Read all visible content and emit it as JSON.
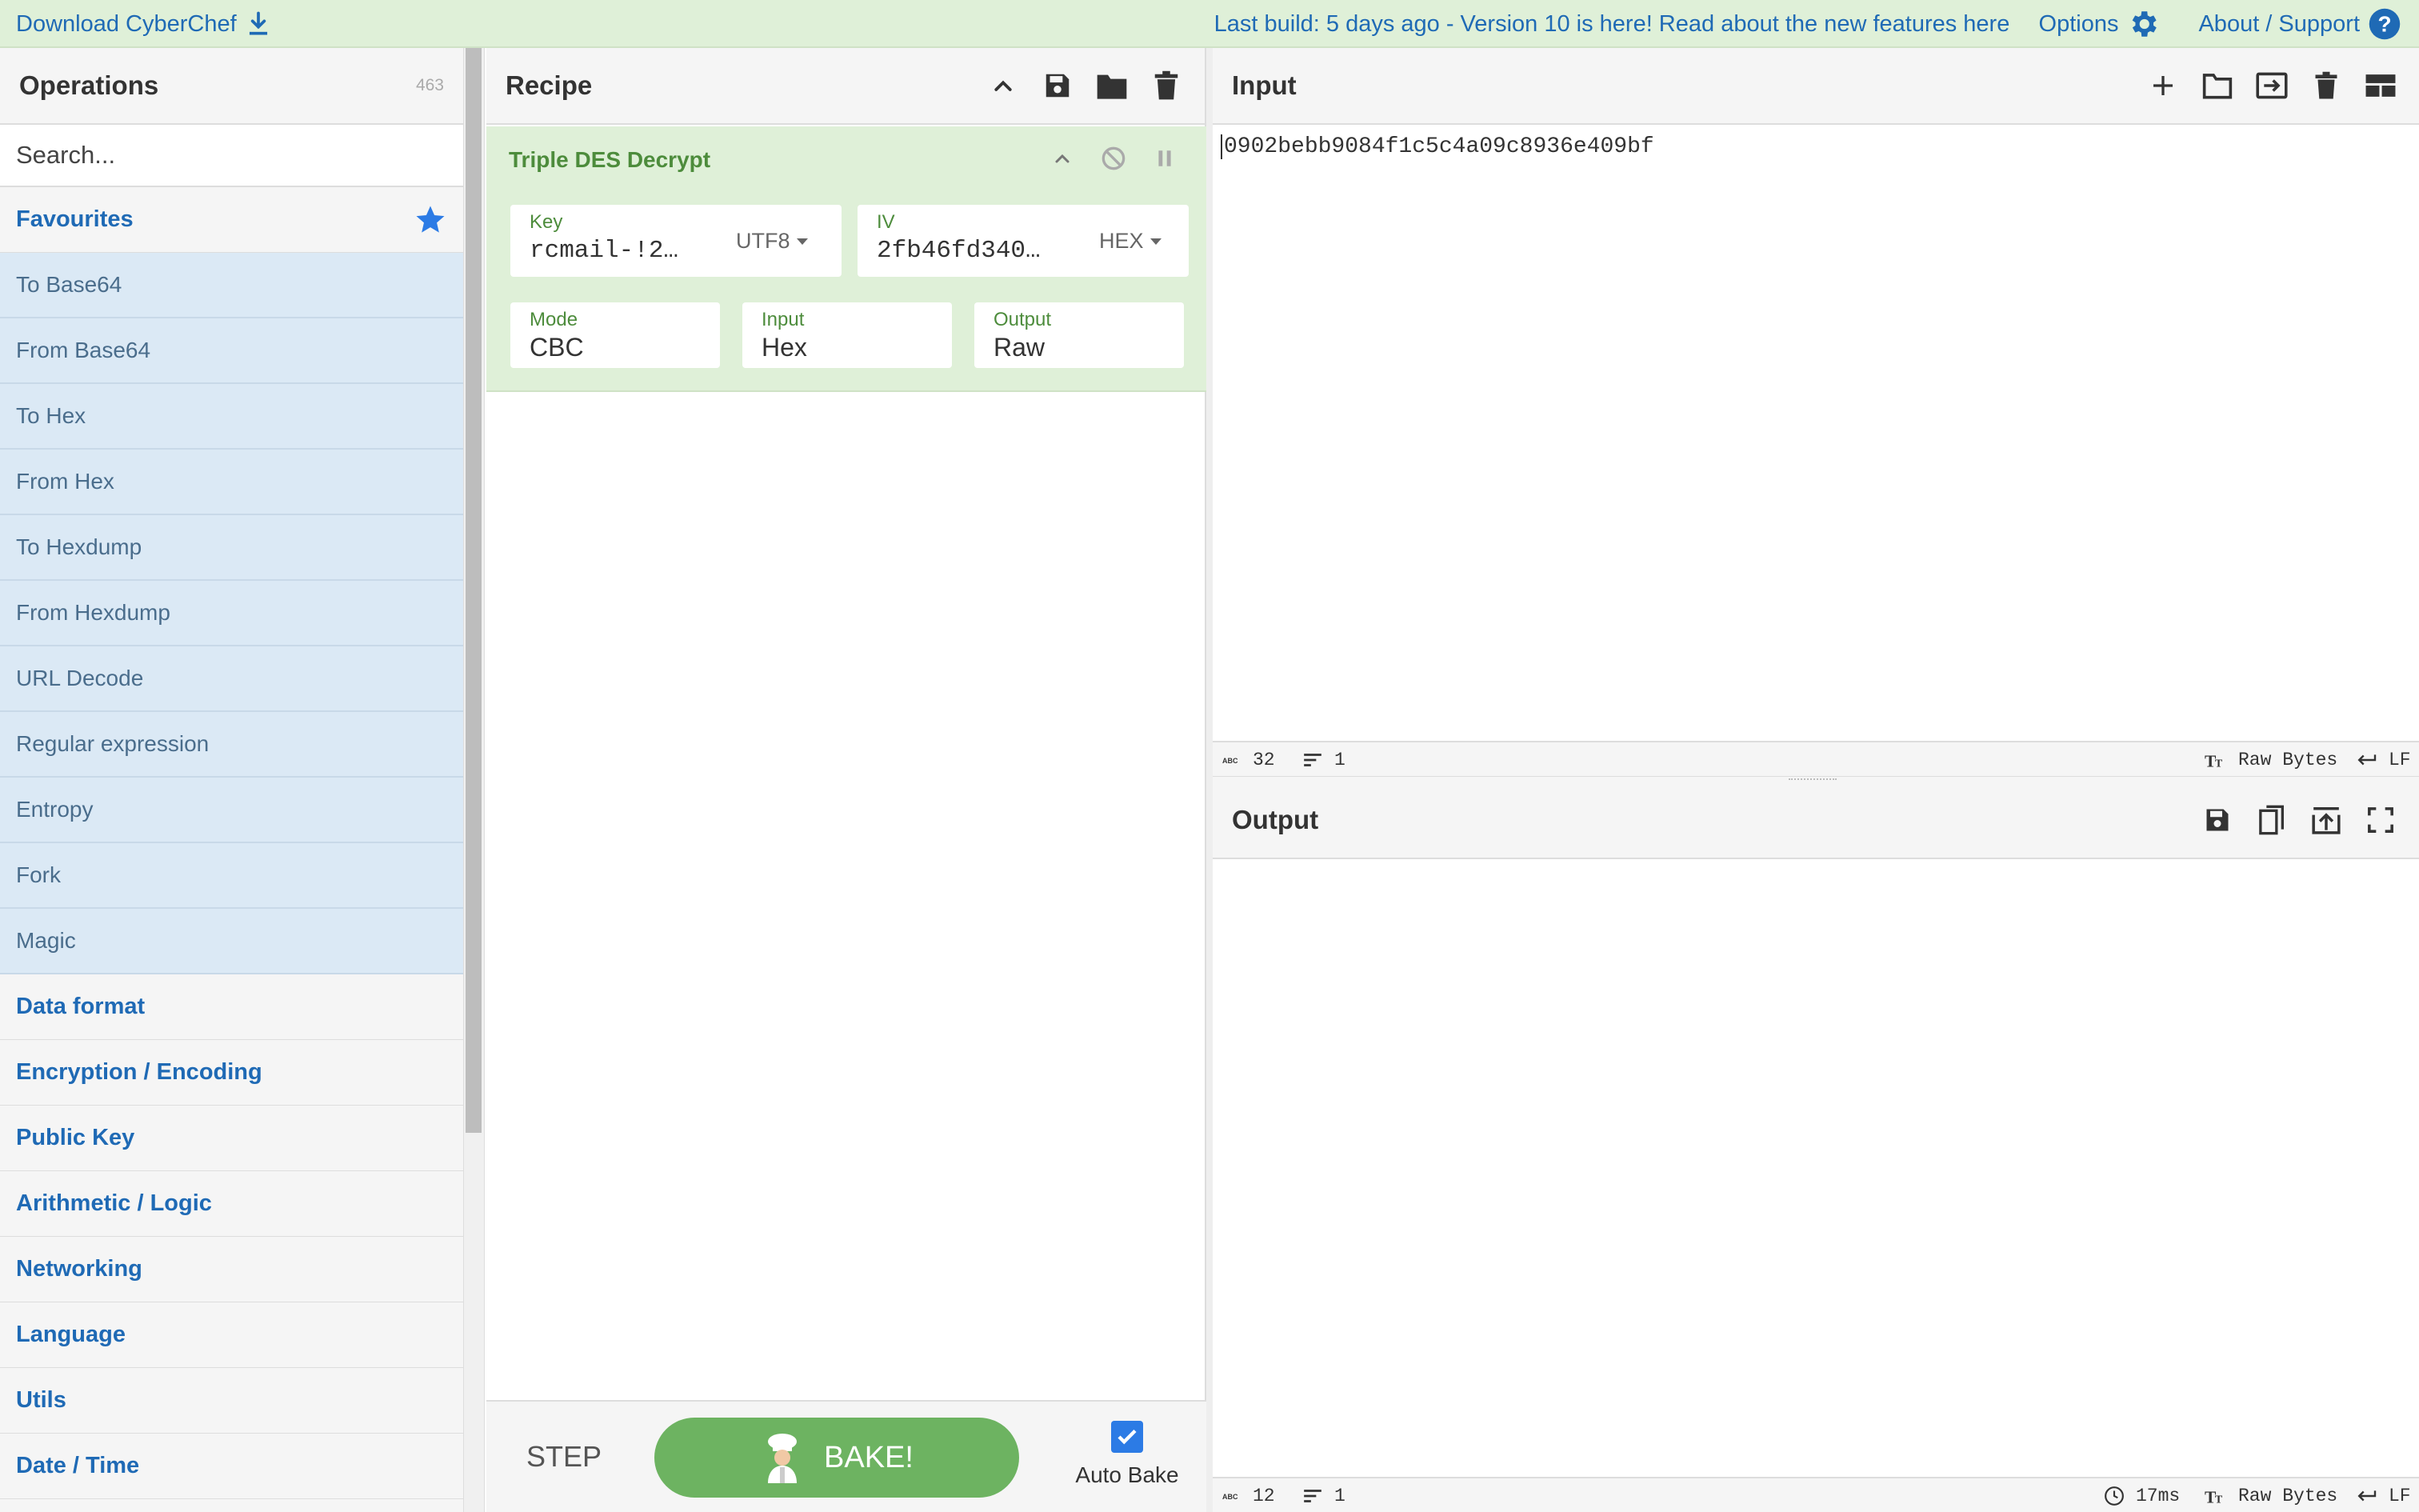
{
  "banner": {
    "download_label": "Download CyberChef",
    "message": "Last build: 5 days ago - Version 10 is here! Read about the new features here",
    "options_label": "Options",
    "about_label": "About / Support"
  },
  "operations": {
    "title": "Operations",
    "count": "463",
    "search_placeholder": "Search...",
    "favourites_label": "Favourites",
    "favourite_ops": [
      "To Base64",
      "From Base64",
      "To Hex",
      "From Hex",
      "To Hexdump",
      "From Hexdump",
      "URL Decode",
      "Regular expression",
      "Entropy",
      "Fork",
      "Magic"
    ],
    "categories": [
      "Data format",
      "Encryption / Encoding",
      "Public Key",
      "Arithmetic / Logic",
      "Networking",
      "Language",
      "Utils",
      "Date / Time"
    ]
  },
  "recipe": {
    "title": "Recipe",
    "operation": {
      "name": "Triple DES Decrypt",
      "key_label": "Key",
      "key_value": "rcmail-!2…",
      "key_encoding": "UTF8",
      "iv_label": "IV",
      "iv_value": "2fb46fd340…",
      "iv_encoding": "HEX",
      "mode_label": "Mode",
      "mode_value": "CBC",
      "input_label": "Input",
      "input_value": "Hex",
      "output_label": "Output",
      "output_value": "Raw"
    },
    "step_label": "STEP",
    "bake_label": "BAKE!",
    "autobake_label": "Auto Bake",
    "autobake_checked": true
  },
  "input": {
    "title": "Input",
    "text": "0902bebb9084f1c5c4a09c8936e409bf",
    "status_chars": "32",
    "status_lines": "1",
    "status_encoding": "Raw Bytes",
    "status_eol": "LF"
  },
  "output": {
    "title": "Output",
    "status_chars": "12",
    "status_lines": "1",
    "status_time": "17ms",
    "status_encoding": "Raw Bytes",
    "status_eol": "LF"
  },
  "colors": {
    "banner_bg": "#dff0d8",
    "link": "#1f6ab5",
    "recipe_op_bg": "#dff0d8",
    "recipe_op_title": "#4d8c3c",
    "favourite_bg": "#dbe9f5",
    "bake_button": "#6db361",
    "checkbox": "#2c7be5"
  }
}
